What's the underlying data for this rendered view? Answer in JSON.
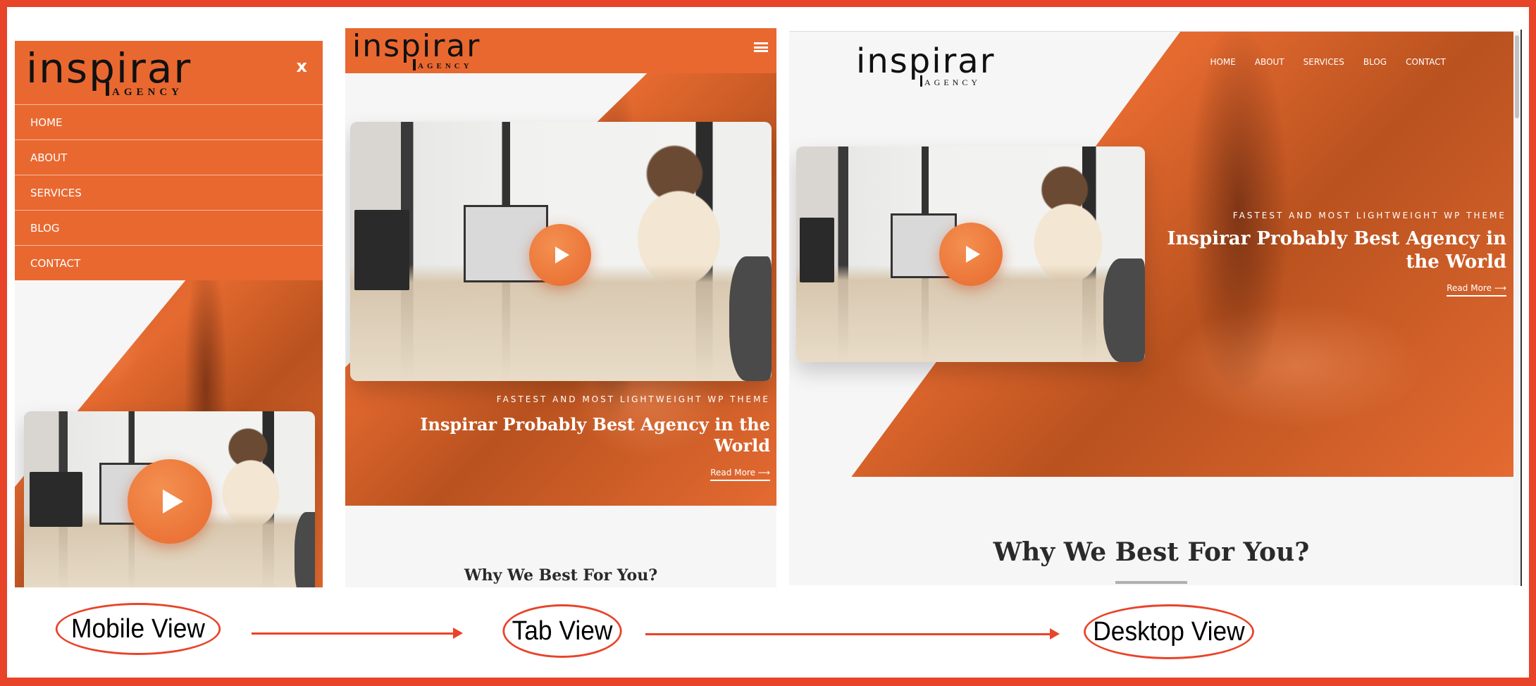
{
  "brand": {
    "logo_word": "inspirar",
    "logo_sub": "AGENCY",
    "accent_color": "#e96830",
    "frame_color": "#e8442a"
  },
  "nav": {
    "items": [
      "HOME",
      "ABOUT",
      "SERVICES",
      "BLOG",
      "CONTACT"
    ],
    "close_label": "x"
  },
  "hero": {
    "eyebrow": "FASTEST AND MOST LIGHTWEIGHT WP THEME",
    "title": "Inspirar Probably Best Agency in the World",
    "read_more": "Read More",
    "read_more_arrow": "⟶"
  },
  "section": {
    "why_title": "Why We Best For You?"
  },
  "views": {
    "mobile": "Mobile View",
    "tab": "Tab View",
    "desktop": "Desktop View"
  },
  "icons": {
    "play": "play-icon",
    "menu": "hamburger-icon",
    "close": "close-icon",
    "arrow": "arrow-right-icon"
  }
}
